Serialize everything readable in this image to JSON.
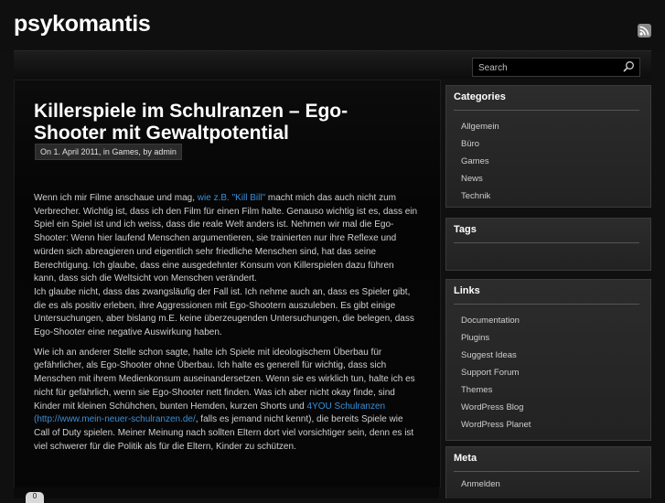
{
  "site": {
    "title": "psykomantis"
  },
  "search": {
    "placeholder": "Search"
  },
  "post": {
    "title": "Killerspiele im Schulranzen – Ego-Shooter mit Gewaltpotential",
    "meta": "On 1. April 2011, in Games, by admin",
    "p1_a": "Wenn ich mir Filme anschaue und mag, ",
    "p1_link": "wie z.B. \"Kill Bill\"",
    "p1_b": " macht mich das auch nicht zum Verbrecher. Wichtig ist, dass ich den Film für einen Film halte. Genauso wichtig ist es, dass ein Spiel ein Spiel ist und ich weiss, dass die reale Welt anders ist. Nehmen wir mal die Ego-Shooter: Wenn hier laufend Menschen argumentieren, sie trainierten nur ihre Reflexe und würden sich abreagieren und eigentlich sehr friedliche Menschen sind, hat das seine Berechtigung. Ich glaube, dass eine ausgedehnter Konsum von Killerspielen dazu führen kann, dass sich die Weltsicht von Menschen verändert.",
    "p1_c": "Ich glaube nicht, dass das zwangsläufig der Fall ist. Ich nehme auch an, dass es Spieler gibt, die es als positiv erleben, ihre Aggressionen mit Ego-Shootern auszuleben. Es gibt einige Untersuchungen, aber bislang m.E. keine überzeugenden Untersuchungen, die belegen, dass Ego-Shooter eine negative Auswirkung haben.",
    "p2_a": "Wie ich an anderer Stelle schon sagte, halte ich Spiele mit ideologischem Überbau für gefährlicher, als Ego-Shooter ohne Überbau. Ich halte es generell für wichtig, dass sich Menschen mit ihrem Medienkonsum auseinandersetzen. Wenn sie es wirklich tun, halte ich es nicht für gefährlich, wenn sie Ego-Shooter nett finden. Was ich aber nicht okay finde, sind Kinder mit kleinen Schühchen, bunten Hemden, kurzen Shorts und ",
    "p2_link": "4YOU Schulranzen (http://www.mein-neuer-schulranzen.de/",
    "p2_b": ", falls es jemand nicht kennt), die bereits Spiele wie Call of Duty spielen. Meiner Meinung nach sollten Eltern dort viel vorsichtiger sein, denn es ist viel schwerer für die Politik als für die Eltern, Kinder zu schützen."
  },
  "comment_badge": "0",
  "widgets": {
    "categories": {
      "title": "Categories",
      "items": [
        "Allgemein",
        "Büro",
        "Games",
        "News",
        "Technik"
      ]
    },
    "tags": {
      "title": "Tags"
    },
    "links": {
      "title": "Links",
      "items": [
        "Documentation",
        "Plugins",
        "Suggest Ideas",
        "Support Forum",
        "Themes",
        "WordPress Blog",
        "WordPress Planet"
      ]
    },
    "meta": {
      "title": "Meta",
      "items": [
        "Anmelden"
      ]
    }
  },
  "icons": {
    "rss": "rss-icon",
    "search": "search-icon"
  }
}
